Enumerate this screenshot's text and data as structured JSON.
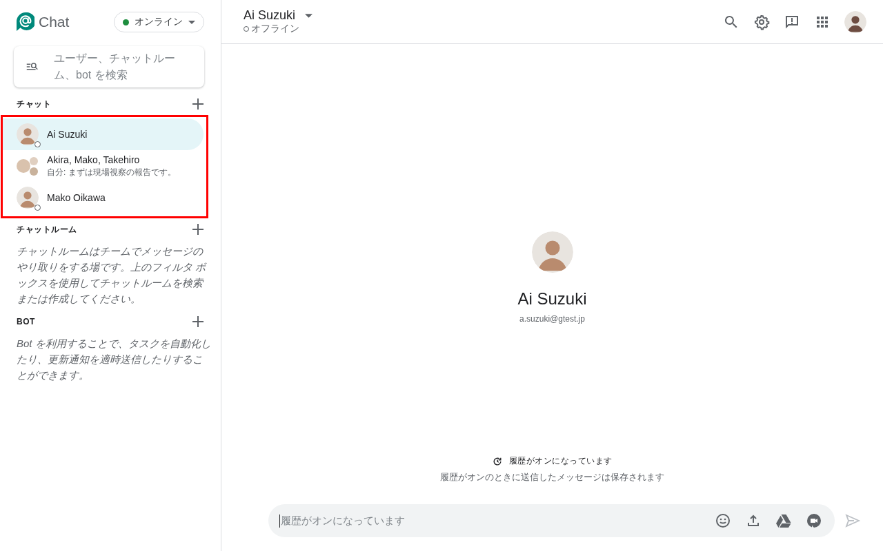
{
  "app": {
    "title": "Chat"
  },
  "status_menu": {
    "label": "オンライン",
    "online": true
  },
  "search": {
    "placeholder": "ユーザー、チャットルーム、bot を検索"
  },
  "sections": [
    {
      "kind": "chats",
      "title": "チャット",
      "highlighted": true,
      "items": [
        {
          "kind": "person",
          "name": "Ai Suzuki",
          "selected": true,
          "offline": true
        },
        {
          "kind": "group",
          "name": "Akira, Mako, Takehiro",
          "preview": "自分: まずは現場視察の報告です。",
          "selected": false,
          "offline": false
        },
        {
          "kind": "person",
          "name": "Mako Oikawa",
          "selected": false,
          "offline": true
        }
      ]
    },
    {
      "kind": "info",
      "title": "チャットルーム",
      "description": "チャットルームはチームでメッセージのやり取りをする場です。上のフィルタ ボックスを使用してチャットルームを検索または作成してください。"
    },
    {
      "kind": "info",
      "title": "BOT",
      "description": "Bot を利用することで、タスクを自動化したり、更新通知を適時送信したりすることができます。"
    }
  ],
  "header": {
    "name": "Ai Suzuki",
    "status_label": "オフライン",
    "offline": true
  },
  "profile": {
    "name": "Ai Suzuki",
    "email": "a.suzuki@gtest.jp"
  },
  "history": {
    "title": "履歴がオンになっています",
    "note": "履歴がオンのときに送信したメッセージは保存されます"
  },
  "composer": {
    "placeholder": "履歴がオンになっています"
  }
}
